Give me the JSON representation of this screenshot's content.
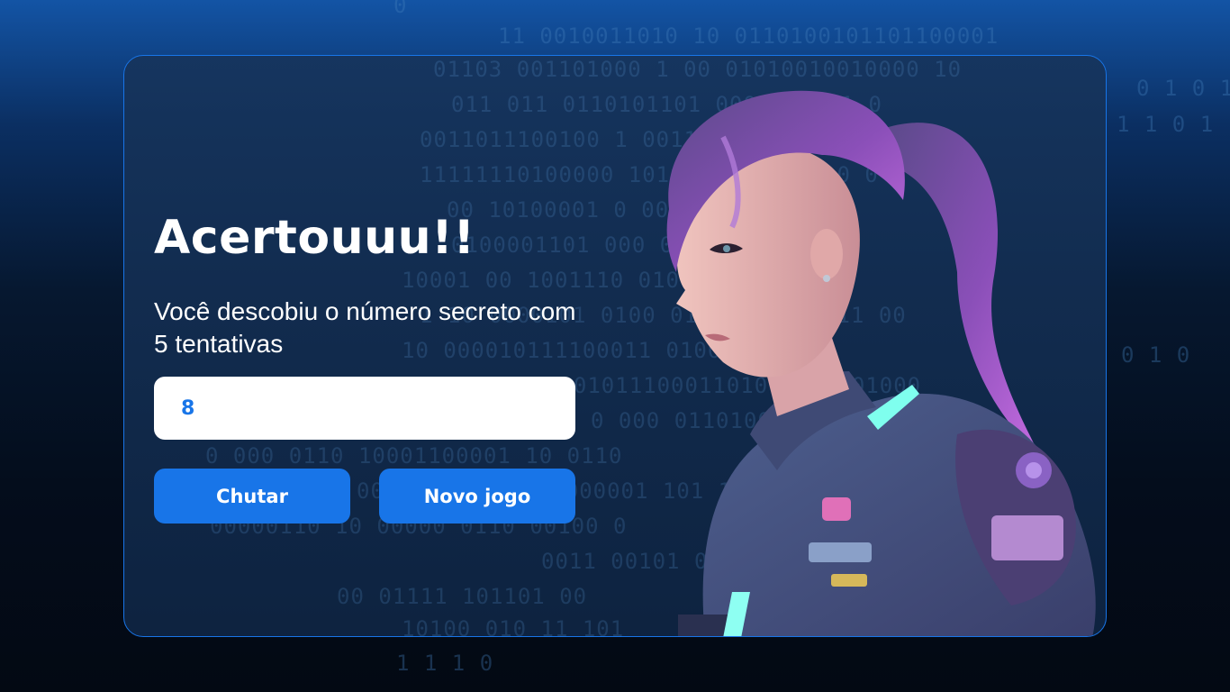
{
  "page": {
    "title": "Acertouuu!!",
    "message": "Você descobiu o número secreto com 5 tentativas"
  },
  "guess_input": {
    "value": "8",
    "placeholder": ""
  },
  "buttons": {
    "guess_label": "Chutar",
    "new_game_label": "Novo jogo"
  },
  "background_codes": [
    "0",
    "11 0010011010 10 0110100101101100001",
    "01103 001101000 1  00 01010010010000 10",
    "011 011 0110101101     00011011 1 0",
    "0011011100100 1 001110  101101000010",
    "11111110100000 10100 00000011 0 0",
    "00 10100001 0      000 001011",
    "0100001101 000  001101  00110 0",
    "10001 00 1001110   010 00 1010010",
    "1 10 0000101  0100 01010000100011 00",
    "10 000010111100011  0100 10001",
    "0101011100011010  1101 01000",
    "0 000  0110100000110 1000110",
    "0 000  0110 10001100001 10 0110",
    "0011 00101  1101000001 101 11 100",
    "00000110  10  00000 0110 00100 0",
    "0011 00101   0011",
    "00 01111   101101 00",
    "10100 010 11 101",
    "1   1   1   0",
    "0 1 0 1",
    "1 1 0 1",
    "0 1 0"
  ],
  "colors": {
    "accent": "#1875e8",
    "card_border": "#1875e8",
    "text": "#ffffff",
    "input_text": "#1875e8"
  }
}
